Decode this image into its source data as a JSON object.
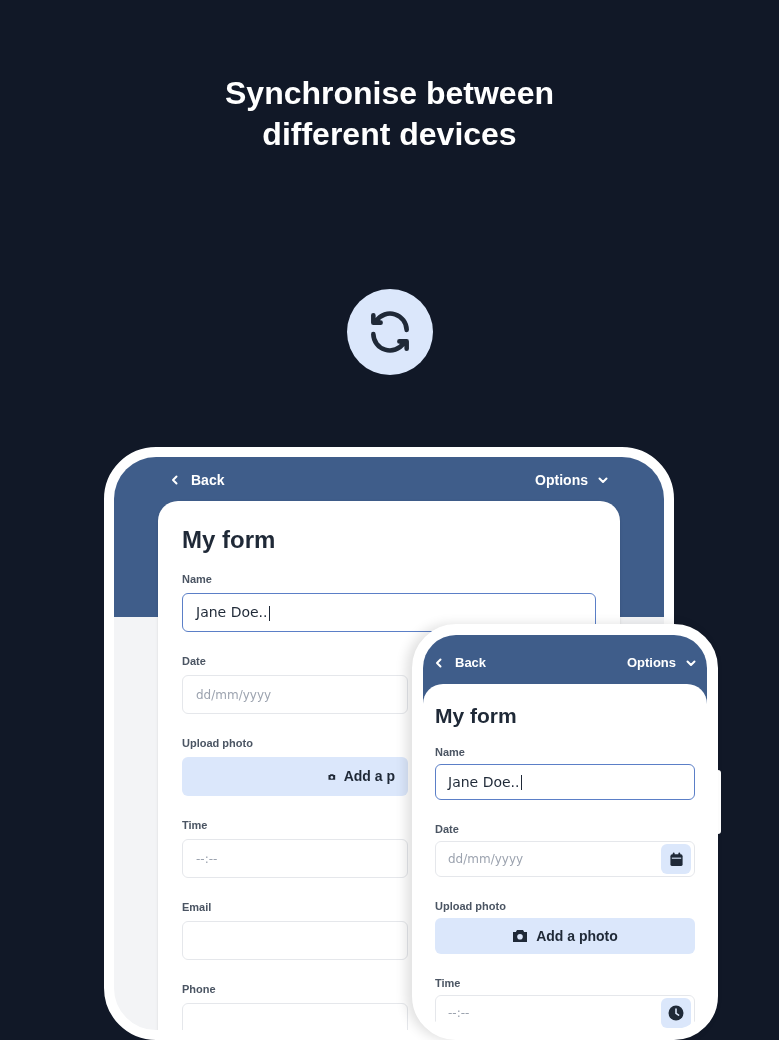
{
  "headline": "Synchronise between different devices",
  "devices": [
    {
      "kind": "tablet",
      "back": "Back",
      "options": "Options",
      "form_title": "My form",
      "fields": [
        {
          "kind": "text",
          "label": "Name",
          "value": "Jane Doe..",
          "focused": true
        },
        {
          "kind": "date",
          "label": "Date",
          "placeholder": "dd/mm/yyyy",
          "picker_button": false
        },
        {
          "kind": "photo",
          "label": "Upload photo",
          "button": "Add a p"
        },
        {
          "kind": "time",
          "label": "Time",
          "placeholder": "--:--",
          "picker_button": false
        },
        {
          "kind": "text",
          "label": "Email",
          "focused": false
        },
        {
          "kind": "text",
          "label": "Phone",
          "focused": false
        }
      ]
    },
    {
      "kind": "phone",
      "back": "Back",
      "options": "Options",
      "form_title": "My form",
      "fields": [
        {
          "kind": "text",
          "label": "Name",
          "value": "Jane Doe..",
          "focused": true
        },
        {
          "kind": "date",
          "label": "Date",
          "placeholder": "dd/mm/yyyy",
          "picker_button": true
        },
        {
          "kind": "photo",
          "label": "Upload photo",
          "button": "Add a photo"
        },
        {
          "kind": "time",
          "label": "Time",
          "placeholder": "--:--",
          "picker_button": true
        }
      ]
    }
  ]
}
